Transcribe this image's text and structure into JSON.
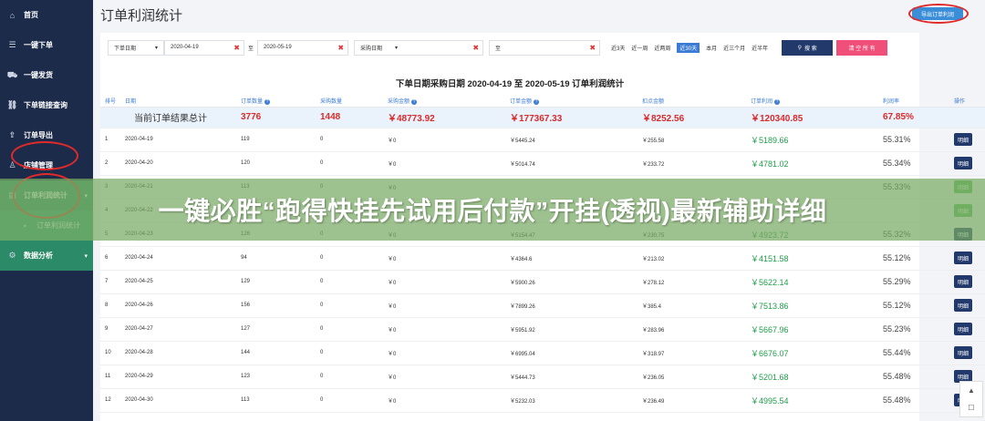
{
  "sidebar": {
    "items": [
      {
        "label": "首页",
        "icon": "home-icon"
      },
      {
        "label": "一键下单",
        "icon": "list-icon"
      },
      {
        "label": "一键发货",
        "icon": "truck-icon"
      },
      {
        "label": "下单链接查询",
        "icon": "link-icon"
      },
      {
        "label": "订单导出",
        "icon": "export-icon"
      },
      {
        "label": "店铺管理",
        "icon": "user-icon"
      },
      {
        "label": "订单利润统计",
        "icon": "chart-icon"
      },
      {
        "label": "订单利润统计",
        "icon": "dot-icon"
      },
      {
        "label": "数据分析",
        "icon": "gear-icon"
      }
    ]
  },
  "header": {
    "title": "订单利润统计",
    "export_label": "导出订单利润"
  },
  "filters": {
    "date_type": "下单日期",
    "date_from": "2020-04-19",
    "to_label": "至",
    "date_to": "2020-05-19",
    "purchase_date": "采购日期",
    "to_label2": "至",
    "quick": [
      "近3天",
      "近一周",
      "近两周",
      "近30天",
      "本月",
      "近三个月",
      "近半年"
    ],
    "quick_active_index": 3,
    "search_label": "搜 索",
    "clear_label": "清 空 所 有"
  },
  "caption": "下单日期采购日期 2020-04-19 至 2020-05-19 订单利润统计",
  "table": {
    "headers": [
      "排号",
      "日期",
      "订单数量",
      "采购数量",
      "采购金额",
      "订单金额",
      "扣点金额",
      "订单利润",
      "利润率",
      "操作"
    ],
    "summary": {
      "label": "当前订单结果总计",
      "orders": "3776",
      "purchase_qty": "1448",
      "purchase_amt": "￥48773.92",
      "order_amt": "￥177367.33",
      "fee_amt": "￥8252.56",
      "profit": "￥120340.85",
      "rate": "67.85%"
    },
    "action_label": "明细",
    "rows": [
      [
        "1",
        "2020-04-19",
        "119",
        "0",
        "￥0",
        "￥5445.24",
        "￥255.58",
        "￥5189.66",
        "55.31%"
      ],
      [
        "2",
        "2020-04-20",
        "120",
        "0",
        "￥0",
        "￥5014.74",
        "￥233.72",
        "￥4781.02",
        "55.34%"
      ],
      [
        "3",
        "2020-04-21",
        "113",
        "0",
        "￥0",
        "",
        "",
        "",
        "55.33%"
      ],
      [
        "4",
        "2020-04-22",
        "",
        "0",
        "",
        "",
        "",
        "",
        ""
      ],
      [
        "5",
        "2020-04-23",
        "126",
        "0",
        "￥0",
        "￥5154.47",
        "￥230.75",
        "￥4923.72",
        "55.32%"
      ],
      [
        "6",
        "2020-04-24",
        "94",
        "0",
        "￥0",
        "￥4364.6",
        "￥213.02",
        "￥4151.58",
        "55.12%"
      ],
      [
        "7",
        "2020-04-25",
        "129",
        "0",
        "￥0",
        "￥5900.26",
        "￥278.12",
        "￥5622.14",
        "55.29%"
      ],
      [
        "8",
        "2020-04-26",
        "156",
        "0",
        "￥0",
        "￥7899.26",
        "￥385.4",
        "￥7513.86",
        "55.12%"
      ],
      [
        "9",
        "2020-04-27",
        "127",
        "0",
        "￥0",
        "￥5951.92",
        "￥283.96",
        "￥5667.96",
        "55.23%"
      ],
      [
        "10",
        "2020-04-28",
        "144",
        "0",
        "￥0",
        "￥6995.04",
        "￥318.97",
        "￥6676.07",
        "55.44%"
      ],
      [
        "11",
        "2020-04-29",
        "123",
        "0",
        "￥0",
        "￥5444.73",
        "￥236.05",
        "￥5201.68",
        "55.48%"
      ],
      [
        "12",
        "2020-04-30",
        "113",
        "0",
        "￥0",
        "￥5232.03",
        "￥236.49",
        "￥4995.54",
        "55.48%"
      ]
    ]
  },
  "banner": "一键必胜“跑得快挂先试用后付款”开挂(透视)最新辅助详细"
}
